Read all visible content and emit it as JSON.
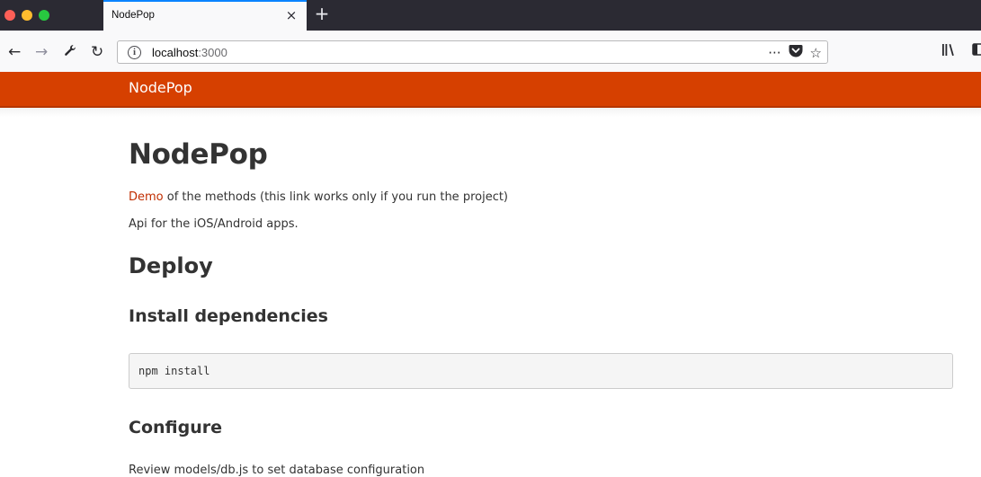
{
  "browser": {
    "traffic_colors": {
      "close": "#fd5f57",
      "minimize": "#febc2e",
      "maximize": "#28c840"
    },
    "tab": {
      "title": "NodePop",
      "close_glyph": "×"
    },
    "new_tab_glyph": "+",
    "nav": {
      "back_glyph": "←",
      "forward_glyph": "→",
      "tools_glyph": "🔧",
      "reload_glyph": "↻"
    },
    "url": {
      "host": "localhost",
      "port": ":3000",
      "info_glyph": "i"
    },
    "url_actions": {
      "more_glyph": "···",
      "pocket_glyph": "⛉",
      "star_glyph": "☆"
    },
    "toolbar_right": {
      "library_glyph": "⫼\\",
      "sidebar_glyph": "◫"
    }
  },
  "site": {
    "brand": "NodePop",
    "accent_color": "#d64000"
  },
  "content": {
    "title": "NodePop",
    "intro_link": "Demo",
    "intro_rest": " of the methods (this link works only if you run the project)",
    "api_text": "Api for the iOS/Android apps.",
    "deploy_heading": "Deploy",
    "install_heading": "Install dependencies",
    "install_code": "npm install",
    "configure_heading": "Configure",
    "configure_text": "Review models/db.js to set database configuration"
  }
}
